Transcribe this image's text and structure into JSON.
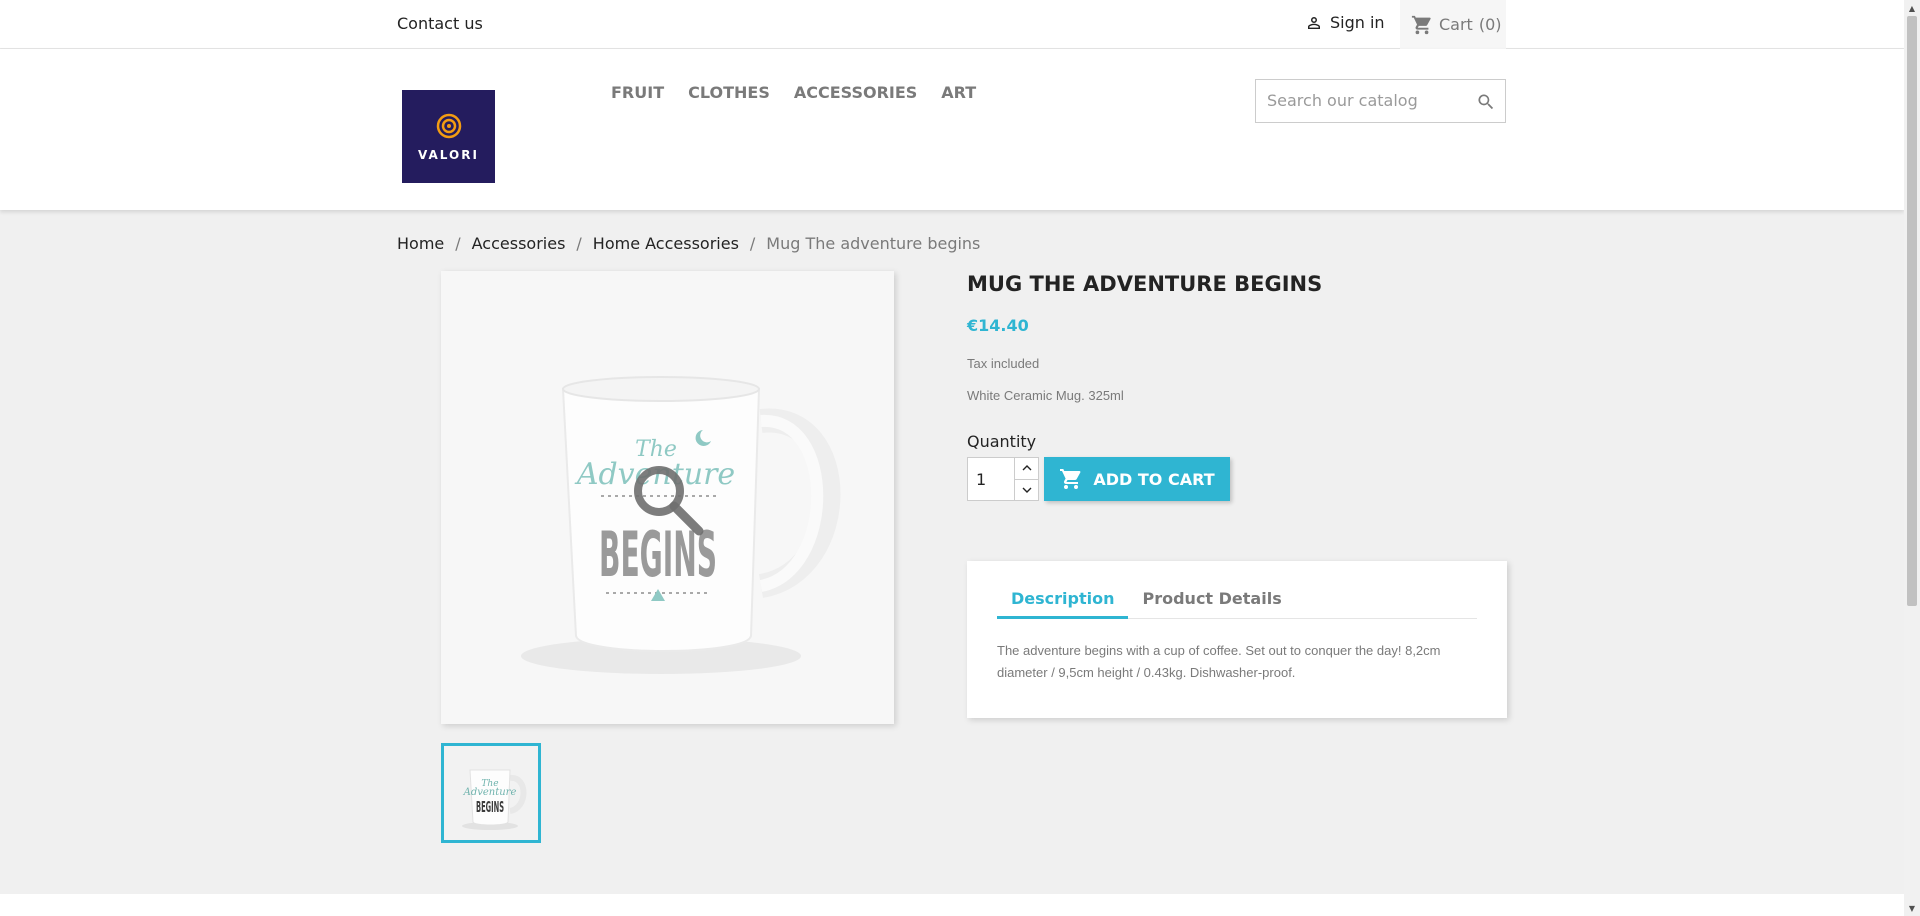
{
  "topbar": {
    "contact_label": "Contact us",
    "signin_label": "Sign in",
    "cart_label": "Cart",
    "cart_count": "(0)"
  },
  "header": {
    "logo_text": "VALORI",
    "nav": [
      "FRUIT",
      "CLOTHES",
      "ACCESSORIES",
      "ART"
    ],
    "search_placeholder": "Search our catalog"
  },
  "breadcrumb": {
    "items": [
      "Home",
      "Accessories",
      "Home Accessories"
    ],
    "current": "Mug The adventure begins"
  },
  "product": {
    "title": "MUG THE ADVENTURE BEGINS",
    "price": "€14.40",
    "tax_note": "Tax included",
    "short_description": "White Ceramic Mug. 325ml",
    "quantity_label": "Quantity",
    "quantity_value": "1",
    "add_to_cart_label": "ADD TO CART",
    "image_text_the": "The",
    "image_text_adventure": "Adventure",
    "image_text_begins": "BEGINS"
  },
  "tabs": {
    "items": [
      "Description",
      "Product Details"
    ],
    "active": "Description",
    "description_text": "The adventure begins with a cup of coffee. Set out to conquer the day! 8,2cm diameter / 9,5cm height / 0.43kg. Dishwasher-proof."
  },
  "colors": {
    "accent": "#2fb5d2",
    "logo_bg": "#241c5e",
    "logo_ring": "#f39c12"
  },
  "icons": [
    "person-icon",
    "cart-icon",
    "search-icon",
    "chevron-up-icon",
    "chevron-down-icon",
    "zoom-icon"
  ]
}
